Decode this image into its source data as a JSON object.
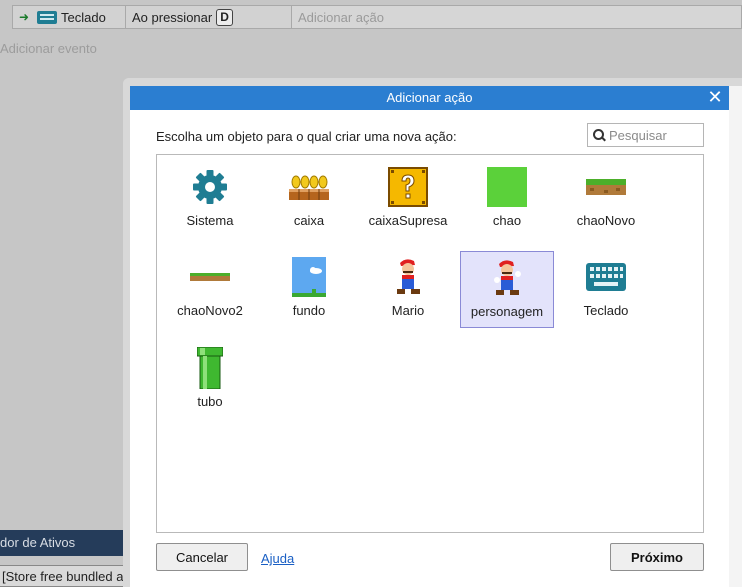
{
  "event_row": {
    "condition_object": "Teclado",
    "condition_text": "Ao pressionar",
    "condition_key": "D",
    "action_placeholder": "Adicionar ação"
  },
  "add_event_label": "Adicionar evento",
  "dock": {
    "title": "dor de Ativos",
    "line": "[Store free bundled as"
  },
  "dialog": {
    "title": "Adicionar ação",
    "prompt": "Escolha um objeto para o qual criar uma nova ação:",
    "search_placeholder": "Pesquisar",
    "objects": [
      {
        "label": "Sistema",
        "icon": "gear-icon",
        "selected": false
      },
      {
        "label": "caixa",
        "icon": "coin-blocks-icon",
        "selected": false
      },
      {
        "label": "caixaSupresa",
        "icon": "question-block-icon",
        "selected": false
      },
      {
        "label": "chao",
        "icon": "green-square-icon",
        "selected": false
      },
      {
        "label": "chaoNovo",
        "icon": "grass-ground-icon",
        "selected": false
      },
      {
        "label": "chaoNovo2",
        "icon": "thin-ground-icon",
        "selected": false
      },
      {
        "label": "fundo",
        "icon": "sky-background-icon",
        "selected": false
      },
      {
        "label": "Mario",
        "icon": "mario-icon",
        "selected": false
      },
      {
        "label": "personagem",
        "icon": "mario-icon",
        "selected": true
      },
      {
        "label": "Teclado",
        "icon": "keyboard-icon",
        "selected": false
      },
      {
        "label": "tubo",
        "icon": "pipe-icon",
        "selected": false
      }
    ],
    "cancel_label": "Cancelar",
    "help_label": "Ajuda",
    "next_label": "Próximo"
  },
  "colors": {
    "titlebar": "#2b7ed1",
    "selection_bg": "#e3e3fb",
    "selection_border": "#8a8ad6",
    "link": "#1a5fc4"
  }
}
